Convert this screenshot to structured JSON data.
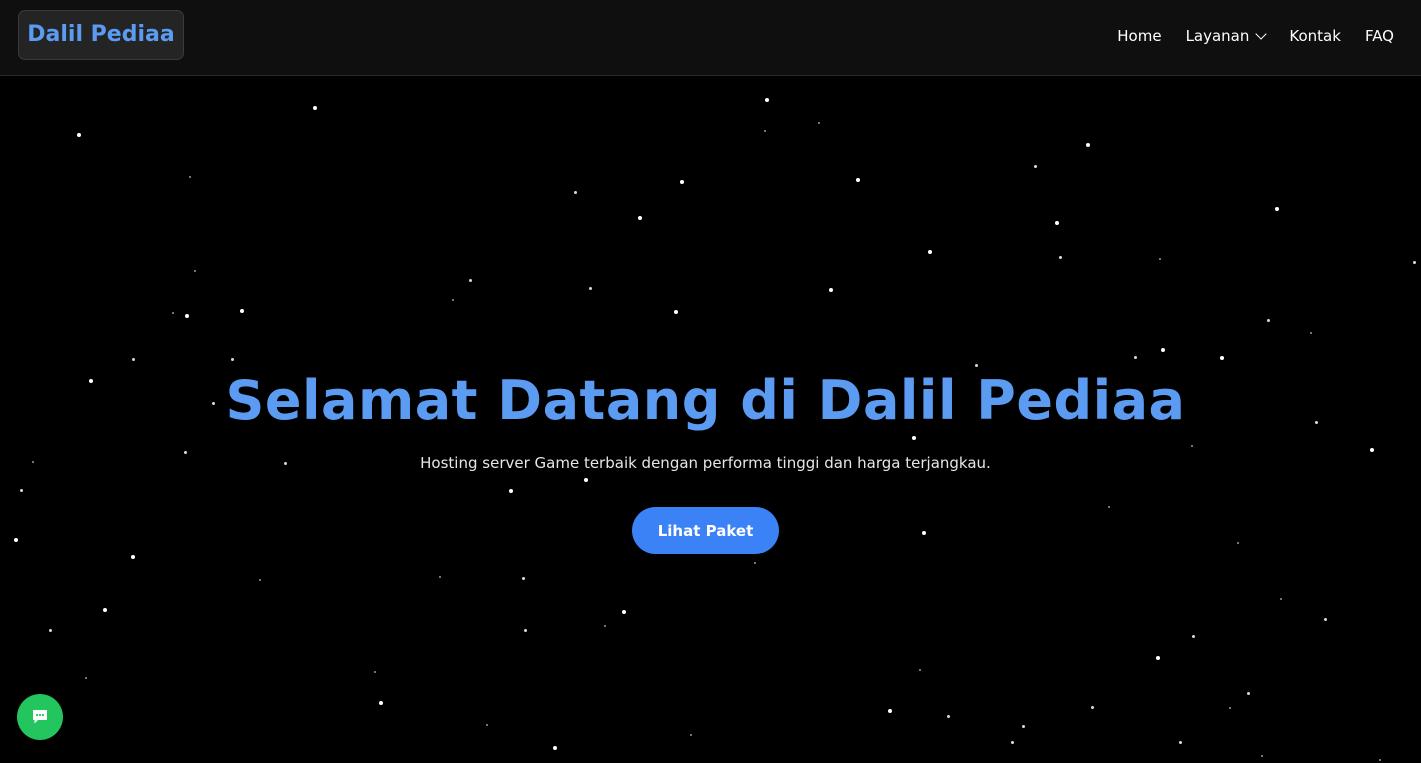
{
  "navbar": {
    "brand": "Dalil Pediaa",
    "links": {
      "home": "Home",
      "layanan": "Layanan",
      "kontak": "Kontak",
      "faq": "FAQ"
    }
  },
  "hero": {
    "title": "Selamat Datang di Dalil Pediaa",
    "subtitle": "Hosting server Game terbaik dengan performa tinggi dan harga terjangkau.",
    "cta_label": "Lihat Paket"
  },
  "chat_button": {
    "icon": "chat-bubble-icon"
  },
  "colors": {
    "background": "#000000",
    "navbar": "#0f0f0f",
    "brand_text": "#5b9cf2",
    "title_text": "#5b9cf2",
    "cta": "#3b82f6",
    "chat_fab": "#22c55e"
  }
}
